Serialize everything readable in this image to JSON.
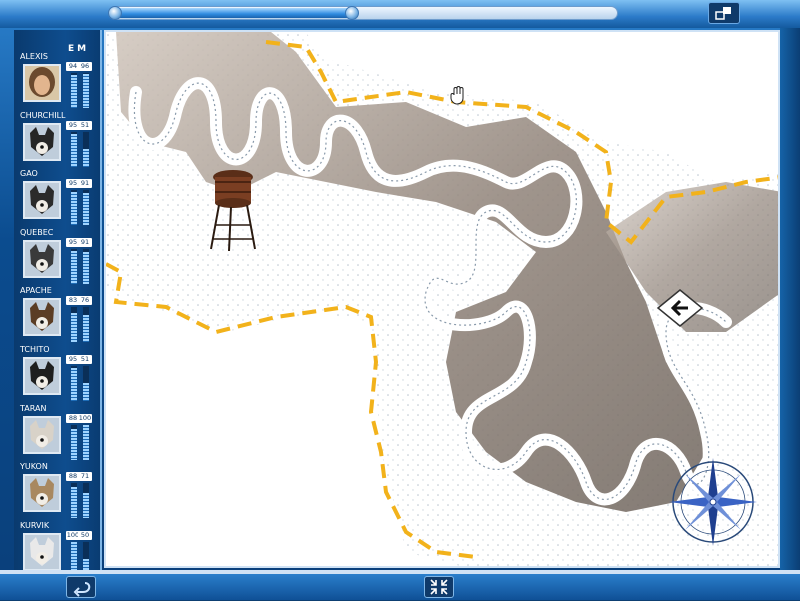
{
  "header": {
    "progress": 0.48,
    "corner_icon": "minimize-window-icon"
  },
  "team": {
    "col_e": "E",
    "col_m": "M",
    "members": [
      {
        "name": "ALEXIS",
        "e": "94",
        "m": "96",
        "kind": "human",
        "fur": "#6b4a2e"
      },
      {
        "name": "CHURCHILL",
        "e": "95",
        "m": "51",
        "kind": "dog",
        "fur": "#262626"
      },
      {
        "name": "GAO",
        "e": "95",
        "m": "91",
        "kind": "dog",
        "fur": "#2b2b2b"
      },
      {
        "name": "QUEBEC",
        "e": "95",
        "m": "91",
        "kind": "dog",
        "fur": "#3a3a3a"
      },
      {
        "name": "APACHE",
        "e": "83",
        "m": "76",
        "kind": "dog",
        "fur": "#5b3d25"
      },
      {
        "name": "TCHITO",
        "e": "95",
        "m": "51",
        "kind": "dog",
        "fur": "#1f1f1f"
      },
      {
        "name": "TARAN",
        "e": "88",
        "m": "100",
        "kind": "dog",
        "fur": "#d8d2c8"
      },
      {
        "name": "YUKON",
        "e": "88",
        "m": "71",
        "kind": "dog",
        "fur": "#a88860"
      },
      {
        "name": "KURVIK",
        "e": "100",
        "m": "50",
        "kind": "dog",
        "fur": "#e9e9e9"
      }
    ]
  },
  "map": {
    "icons": [
      "water-tower-icon",
      "hand-cursor-icon",
      "direction-arrow-icon",
      "compass-rose-icon"
    ]
  },
  "footer": {
    "left_icon": "back-icon",
    "center_icon": "zoom-icon"
  },
  "colors": {
    "accent": "#0e4d8e",
    "trail": "#f2b21b",
    "trail_path": "#ffffff",
    "rock": "#9b8f86"
  }
}
